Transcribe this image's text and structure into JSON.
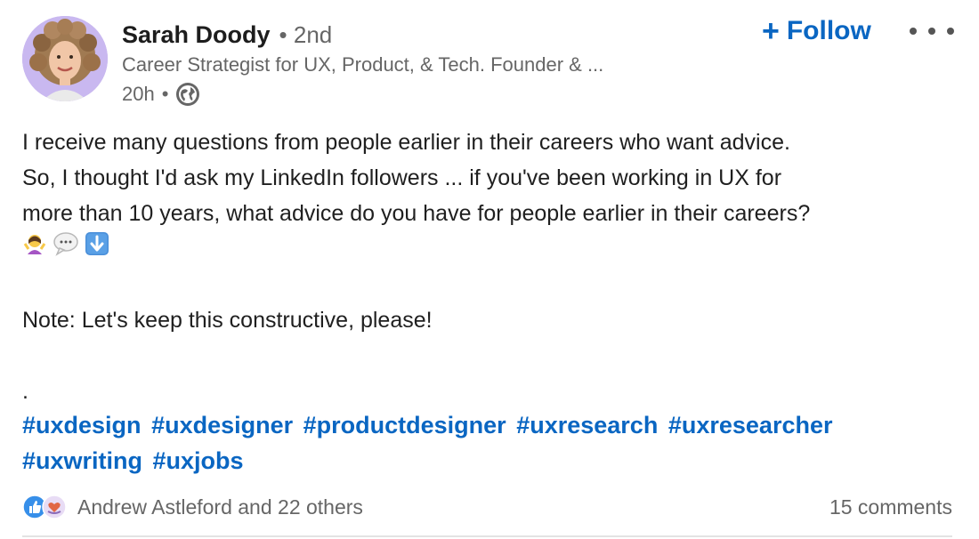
{
  "author": {
    "name": "Sarah Doody",
    "degree": "• 2nd",
    "headline": "Career Strategist for UX, Product, & Tech. Founder & ...",
    "time": "20h",
    "visibility_icon": "globe-icon"
  },
  "actions": {
    "follow_label": "Follow",
    "follow_icon": "plus-icon",
    "more_icon": "more-horizontal-icon"
  },
  "post": {
    "lines": [
      "I receive many questions from people earlier in their careers who want advice.",
      "So, I thought I'd ask my LinkedIn followers ... if you've been working in UX for",
      "more than 10 years, what advice do you have for people earlier in their careers?"
    ],
    "emojis": [
      "woman-shrugging-emoji",
      "speech-bubble-emoji",
      "down-arrow-emoji"
    ],
    "note": "Note: Let's keep this constructive, please!",
    "dot": "."
  },
  "hashtags": [
    "#uxdesign",
    "#uxdesigner",
    "#productdesigner",
    "#uxresearch",
    "#uxresearcher",
    "#uxwriting",
    "#uxjobs"
  ],
  "social": {
    "reactions_text": "Andrew Astleford and 22 others",
    "reaction_icons": [
      "like-icon",
      "love-icon"
    ],
    "comments_text": "15 comments"
  },
  "colors": {
    "accent": "#0a66c2",
    "secondary_text": "#666666"
  }
}
